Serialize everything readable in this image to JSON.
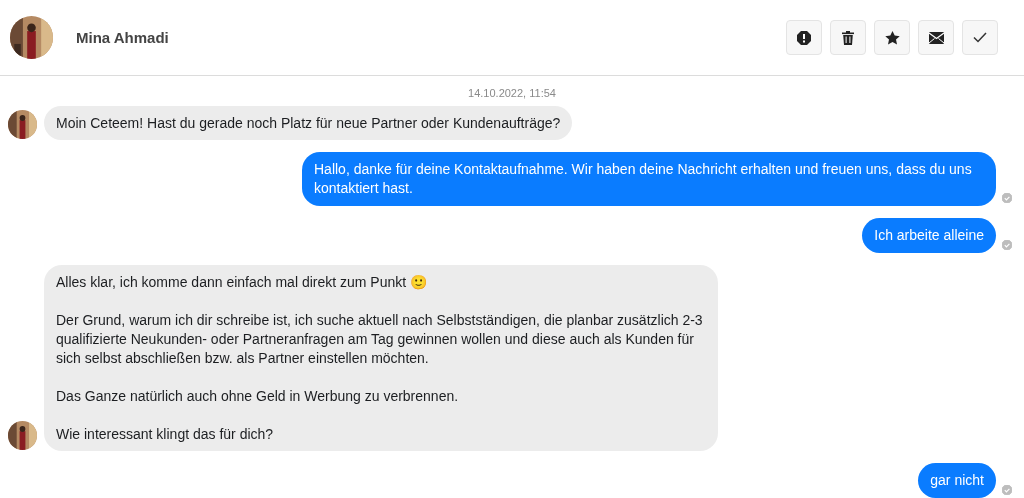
{
  "header": {
    "name": "Mina Ahmadi",
    "actions": [
      {
        "kind": "report"
      },
      {
        "kind": "delete"
      },
      {
        "kind": "star"
      },
      {
        "kind": "mail"
      },
      {
        "kind": "done"
      }
    ]
  },
  "timestamp": "14.10.2022, 11:54",
  "messages": [
    {
      "kind": "incoming",
      "avatar": true,
      "paragraphs": [
        "Moin Ceteem! Hast du gerade noch Platz für neue Partner oder Kundenaufträge?"
      ]
    },
    {
      "kind": "outgoing",
      "read": true,
      "paragraphs": [
        "Hallo, danke für deine Kontaktaufnahme. Wir haben deine Nachricht erhalten und freuen uns, dass du uns kontaktiert hast."
      ]
    },
    {
      "kind": "outgoing",
      "read": true,
      "paragraphs": [
        "Ich arbeite alleine"
      ]
    },
    {
      "kind": "incoming",
      "avatar": true,
      "paragraphs": [
        "Alles klar, ich komme dann einfach mal direkt zum Punkt 🙂",
        "Der Grund, warum ich dir schreibe ist, ich suche aktuell nach Selbstständigen, die planbar zusätzlich 2-3 qualifizierte Neukunden- oder Partneranfragen am Tag gewinnen wollen und diese auch als Kunden für sich selbst abschließen bzw. als Partner einstellen möchten.",
        "Das Ganze natürlich auch ohne Geld in Werbung zu verbrennen.",
        "Wie interessant klingt das für dich?"
      ]
    },
    {
      "kind": "outgoing",
      "read": true,
      "paragraphs": [
        "gar nicht"
      ]
    }
  ]
}
